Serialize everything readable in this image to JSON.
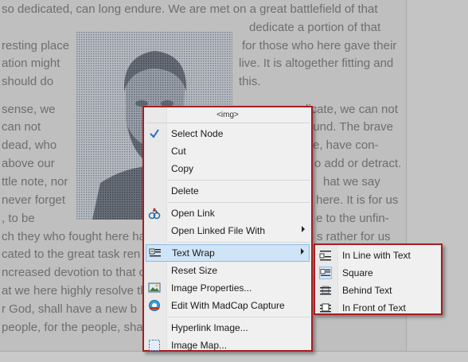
{
  "document": {
    "lines": [
      "so dedicated, can long endure. We are met on a great battlefield of that",
      "dedicate a portion of that",
      "resting place",
      "for those who here gave their",
      "ation might",
      "live. It is altogether fitting and",
      "should do",
      "this.",
      "sense, we",
      "licate, we can not",
      "can not",
      "round. The brave",
      "dead, who",
      "e, have con-",
      "above our",
      "o add or detract.",
      "ttle note, nor",
      "hat we say",
      "never forget",
      "here. It is for us",
      ", to be",
      "e to the unfin-",
      "ch they who fought here ha",
      "s rather for us",
      "cated to the great task ren",
      "ncreased devotion to that c",
      "at we here highly resolve th",
      "r God, shall have a new b",
      "people, for the people, sha"
    ]
  },
  "context_menu": {
    "header": "<img>",
    "items": [
      {
        "label": "Select Node",
        "icon": "checkmark-icon"
      },
      {
        "label": "Cut"
      },
      {
        "label": "Copy"
      },
      {
        "label": "Delete"
      },
      {
        "label": "Open Link",
        "icon": "open-link-icon"
      },
      {
        "label": "Open Linked File With",
        "submenu": true
      },
      {
        "label": "Text Wrap",
        "icon": "text-wrap-icon",
        "submenu": true,
        "highlighted": true
      },
      {
        "label": "Reset Size"
      },
      {
        "label": "Image Properties...",
        "icon": "image-properties-icon"
      },
      {
        "label": "Edit With MadCap Capture",
        "icon": "madcap-capture-icon"
      },
      {
        "label": "Hyperlink Image..."
      },
      {
        "label": "Image Map...",
        "icon": "image-map-icon"
      }
    ]
  },
  "text_wrap_submenu": {
    "items": [
      {
        "label": "In Line with Text",
        "icon": "inline-wrap-icon"
      },
      {
        "label": "Square",
        "icon": "square-wrap-icon",
        "checked": true
      },
      {
        "label": "Behind Text",
        "icon": "behind-text-icon"
      },
      {
        "label": "In Front of Text",
        "icon": "in-front-text-icon"
      }
    ]
  },
  "colors": {
    "menu_border": "#a61e22",
    "highlight": "#cfe4f7",
    "checkmark": "#2a6cc0"
  }
}
